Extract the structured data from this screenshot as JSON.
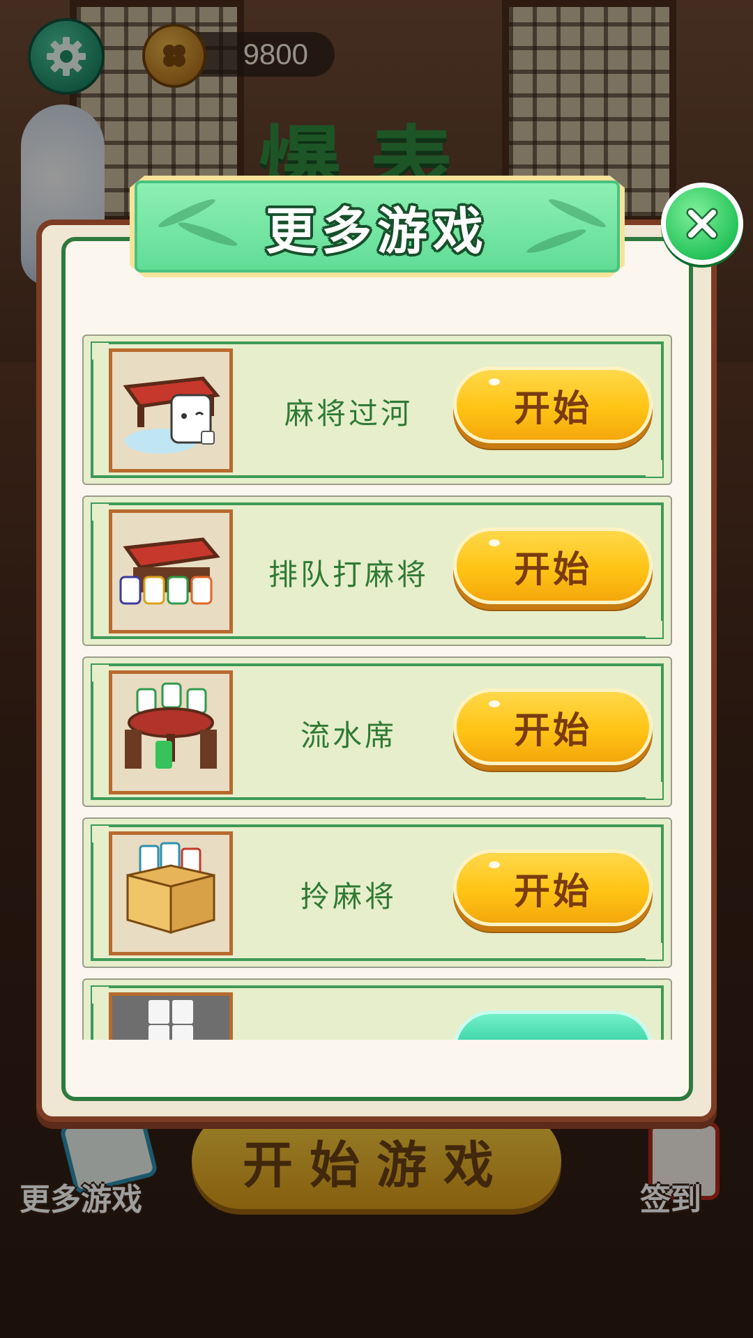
{
  "hud": {
    "coins": "9800",
    "settings_icon": "gear-icon",
    "coin_icon": "clover-coin-icon"
  },
  "background": {
    "title": "爆表",
    "start_game_label": "开始游戏",
    "more_games_label": "更多游戏",
    "checkin_label": "签到"
  },
  "dialog": {
    "title": "更多游戏",
    "close_icon": "close-icon",
    "games": [
      {
        "name": "麻将过河",
        "button": "开始",
        "thumb": "mahjong-crossing-thumb"
      },
      {
        "name": "排队打麻将",
        "button": "开始",
        "thumb": "queue-mahjong-thumb"
      },
      {
        "name": "流水席",
        "button": "开始",
        "thumb": "banquet-thumb"
      },
      {
        "name": "拎麻将",
        "button": "开始",
        "thumb": "box-mahjong-thumb"
      },
      {
        "name": "",
        "button": "",
        "thumb": "tiles-board-thumb"
      }
    ]
  },
  "colors": {
    "accent_green": "#2e7a3e",
    "button_yellow": "#ffc414",
    "panel_brown": "#7c3d24"
  }
}
